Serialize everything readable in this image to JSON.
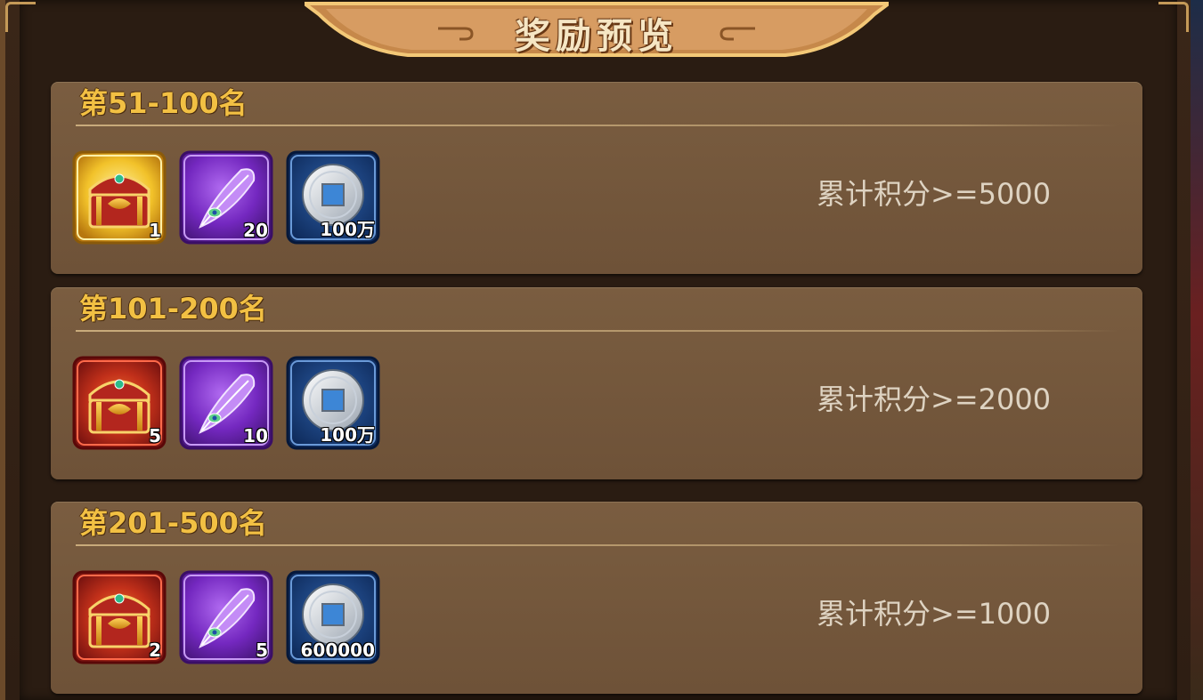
{
  "title": "奖励预览",
  "tiers": [
    {
      "rank": "第51-100名",
      "score": "累计积分>=5000",
      "items": [
        {
          "icon": "gold-treasure-chest",
          "count": "1"
        },
        {
          "icon": "purple-feather",
          "count": "20"
        },
        {
          "icon": "silver-coin",
          "count": "100万"
        }
      ]
    },
    {
      "rank": "第101-200名",
      "score": "累计积分>=2000",
      "items": [
        {
          "icon": "red-treasure-chest",
          "count": "5"
        },
        {
          "icon": "purple-feather",
          "count": "10"
        },
        {
          "icon": "silver-coin",
          "count": "100万"
        }
      ]
    },
    {
      "rank": "第201-500名",
      "score": "累计积分>=1000",
      "items": [
        {
          "icon": "red-treasure-chest",
          "count": "2"
        },
        {
          "icon": "purple-feather",
          "count": "5"
        },
        {
          "icon": "silver-coin",
          "count": "600000"
        }
      ]
    }
  ],
  "colors": {
    "panel": "#735740",
    "rank_text": "#f2c043",
    "score_text": "#ded3c2",
    "gold_frame": "#f0b820",
    "red_frame": "#c81e1e",
    "purple_frame": "#7b2fc0",
    "blue_frame": "#17407e"
  }
}
